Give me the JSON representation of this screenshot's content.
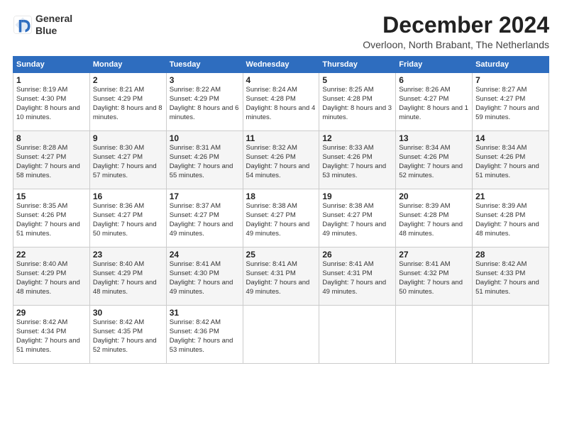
{
  "logo": {
    "line1": "General",
    "line2": "Blue"
  },
  "title": "December 2024",
  "subtitle": "Overloon, North Brabant, The Netherlands",
  "weekdays": [
    "Sunday",
    "Monday",
    "Tuesday",
    "Wednesday",
    "Thursday",
    "Friday",
    "Saturday"
  ],
  "weeks": [
    [
      {
        "day": "1",
        "sunrise": "8:19 AM",
        "sunset": "4:30 PM",
        "daylight": "8 hours and 10 minutes."
      },
      {
        "day": "2",
        "sunrise": "8:21 AM",
        "sunset": "4:29 PM",
        "daylight": "8 hours and 8 minutes."
      },
      {
        "day": "3",
        "sunrise": "8:22 AM",
        "sunset": "4:29 PM",
        "daylight": "8 hours and 6 minutes."
      },
      {
        "day": "4",
        "sunrise": "8:24 AM",
        "sunset": "4:28 PM",
        "daylight": "8 hours and 4 minutes."
      },
      {
        "day": "5",
        "sunrise": "8:25 AM",
        "sunset": "4:28 PM",
        "daylight": "8 hours and 3 minutes."
      },
      {
        "day": "6",
        "sunrise": "8:26 AM",
        "sunset": "4:27 PM",
        "daylight": "8 hours and 1 minute."
      },
      {
        "day": "7",
        "sunrise": "8:27 AM",
        "sunset": "4:27 PM",
        "daylight": "7 hours and 59 minutes."
      }
    ],
    [
      {
        "day": "8",
        "sunrise": "8:28 AM",
        "sunset": "4:27 PM",
        "daylight": "7 hours and 58 minutes."
      },
      {
        "day": "9",
        "sunrise": "8:30 AM",
        "sunset": "4:27 PM",
        "daylight": "7 hours and 57 minutes."
      },
      {
        "day": "10",
        "sunrise": "8:31 AM",
        "sunset": "4:26 PM",
        "daylight": "7 hours and 55 minutes."
      },
      {
        "day": "11",
        "sunrise": "8:32 AM",
        "sunset": "4:26 PM",
        "daylight": "7 hours and 54 minutes."
      },
      {
        "day": "12",
        "sunrise": "8:33 AM",
        "sunset": "4:26 PM",
        "daylight": "7 hours and 53 minutes."
      },
      {
        "day": "13",
        "sunrise": "8:34 AM",
        "sunset": "4:26 PM",
        "daylight": "7 hours and 52 minutes."
      },
      {
        "day": "14",
        "sunrise": "8:34 AM",
        "sunset": "4:26 PM",
        "daylight": "7 hours and 51 minutes."
      }
    ],
    [
      {
        "day": "15",
        "sunrise": "8:35 AM",
        "sunset": "4:26 PM",
        "daylight": "7 hours and 51 minutes."
      },
      {
        "day": "16",
        "sunrise": "8:36 AM",
        "sunset": "4:27 PM",
        "daylight": "7 hours and 50 minutes."
      },
      {
        "day": "17",
        "sunrise": "8:37 AM",
        "sunset": "4:27 PM",
        "daylight": "7 hours and 49 minutes."
      },
      {
        "day": "18",
        "sunrise": "8:38 AM",
        "sunset": "4:27 PM",
        "daylight": "7 hours and 49 minutes."
      },
      {
        "day": "19",
        "sunrise": "8:38 AM",
        "sunset": "4:27 PM",
        "daylight": "7 hours and 49 minutes."
      },
      {
        "day": "20",
        "sunrise": "8:39 AM",
        "sunset": "4:28 PM",
        "daylight": "7 hours and 48 minutes."
      },
      {
        "day": "21",
        "sunrise": "8:39 AM",
        "sunset": "4:28 PM",
        "daylight": "7 hours and 48 minutes."
      }
    ],
    [
      {
        "day": "22",
        "sunrise": "8:40 AM",
        "sunset": "4:29 PM",
        "daylight": "7 hours and 48 minutes."
      },
      {
        "day": "23",
        "sunrise": "8:40 AM",
        "sunset": "4:29 PM",
        "daylight": "7 hours and 48 minutes."
      },
      {
        "day": "24",
        "sunrise": "8:41 AM",
        "sunset": "4:30 PM",
        "daylight": "7 hours and 49 minutes."
      },
      {
        "day": "25",
        "sunrise": "8:41 AM",
        "sunset": "4:31 PM",
        "daylight": "7 hours and 49 minutes."
      },
      {
        "day": "26",
        "sunrise": "8:41 AM",
        "sunset": "4:31 PM",
        "daylight": "7 hours and 49 minutes."
      },
      {
        "day": "27",
        "sunrise": "8:41 AM",
        "sunset": "4:32 PM",
        "daylight": "7 hours and 50 minutes."
      },
      {
        "day": "28",
        "sunrise": "8:42 AM",
        "sunset": "4:33 PM",
        "daylight": "7 hours and 51 minutes."
      }
    ],
    [
      {
        "day": "29",
        "sunrise": "8:42 AM",
        "sunset": "4:34 PM",
        "daylight": "7 hours and 51 minutes."
      },
      {
        "day": "30",
        "sunrise": "8:42 AM",
        "sunset": "4:35 PM",
        "daylight": "7 hours and 52 minutes."
      },
      {
        "day": "31",
        "sunrise": "8:42 AM",
        "sunset": "4:36 PM",
        "daylight": "7 hours and 53 minutes."
      },
      null,
      null,
      null,
      null
    ]
  ]
}
